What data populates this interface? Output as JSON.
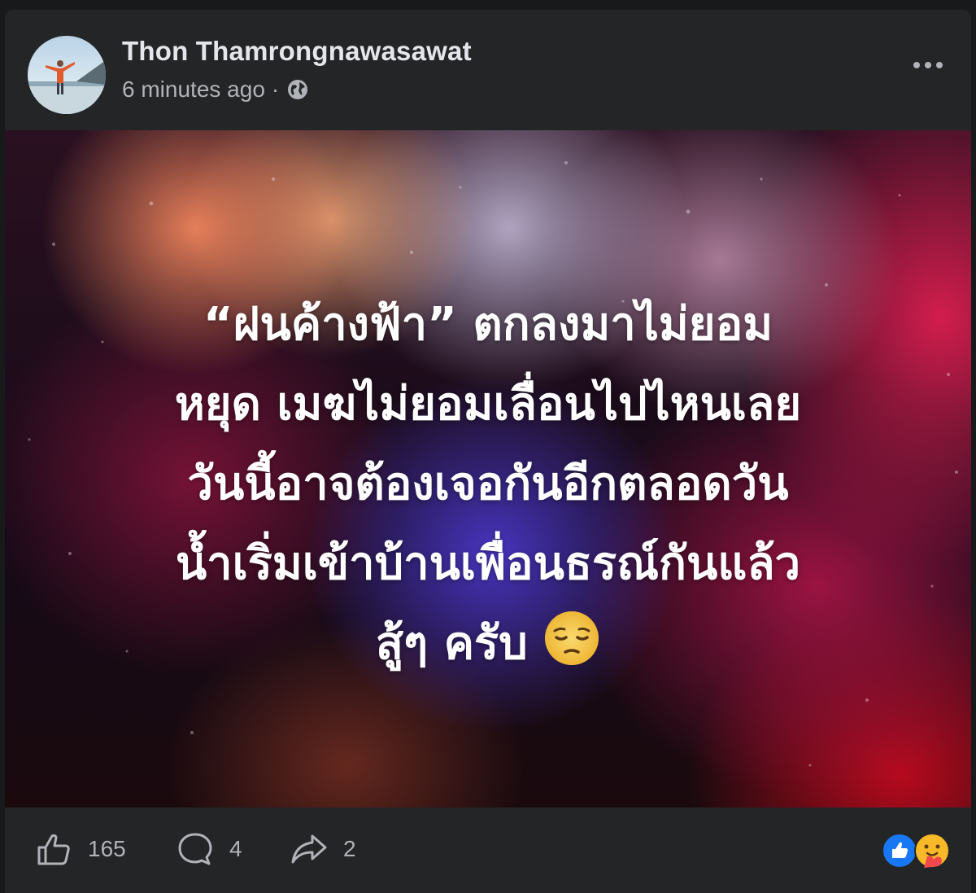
{
  "post": {
    "author": "Thon Thamrongnawasawat",
    "time": "6 minutes ago",
    "separator": "·",
    "privacy_icon": "globe-icon",
    "more_icon": "more-options-icon"
  },
  "image_text": {
    "lines": [
      "“ฝนค้างฟ้า” ตกลงมาไม่ยอม",
      "หยุด เมฆไม่ยอมเลื่อนไปไหนเลย",
      "วันนี้อาจต้องเจอกันอีกตลอดวัน",
      "น้ำเริ่มเข้าบ้านเพื่อนธรณ์กันแล้ว",
      "สู้ๆ ครับ"
    ],
    "emoji": "pensive-face-icon",
    "background": "blurred rain bokeh, red purple orange"
  },
  "footer": {
    "like_count": "165",
    "comment_count": "4",
    "share_count": "2",
    "reaction_icons": [
      "like-reaction-icon",
      "care-reaction-icon"
    ]
  },
  "colors": {
    "page_bg": "#18191a",
    "card_bg": "#242526",
    "primary_text": "#e4e6eb",
    "secondary_text": "#b0b3b8",
    "like_blue": "#1877f2",
    "care_yellow": "#f7b928"
  }
}
